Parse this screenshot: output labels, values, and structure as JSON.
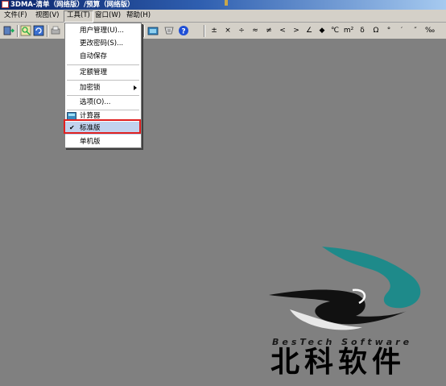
{
  "window": {
    "title": "3DMA-清单（网络版）/预算（网络版）"
  },
  "menubar": {
    "items": [
      {
        "label": "文件(F)"
      },
      {
        "label": "视图(V)"
      },
      {
        "label": "工具(T)"
      },
      {
        "label": "窗口(W)"
      },
      {
        "label": "帮助(H)"
      }
    ]
  },
  "toolbar": {
    "buttons": [
      "exit-icon",
      "search-icon",
      "refresh-icon",
      "print-icon",
      "folder-icon",
      "settings-icon",
      "help-icon"
    ],
    "symbols": [
      "±",
      "×",
      "÷",
      "≈",
      "≠",
      "<",
      ">",
      "∠",
      "◆",
      "℃",
      "m²",
      "δ",
      "Ω",
      "°",
      "′",
      "″",
      "‰"
    ]
  },
  "tools_menu": {
    "items": [
      {
        "label": "用户管理(U)..."
      },
      {
        "label": "更改密码(S)..."
      },
      {
        "label": "自动保存"
      },
      {
        "label": "定额管理"
      },
      {
        "label": "加密锁"
      },
      {
        "label": "选项(O)..."
      },
      {
        "label": "计算器"
      },
      {
        "label": "标准版",
        "checked": true,
        "check_mark": "✔"
      },
      {
        "label": "单机版"
      }
    ]
  },
  "logo": {
    "english": "BesTech Software",
    "chinese": "北科软件",
    "colors": {
      "teal": "#1e8a8a",
      "black": "#000000",
      "white": "#ffffff"
    }
  }
}
